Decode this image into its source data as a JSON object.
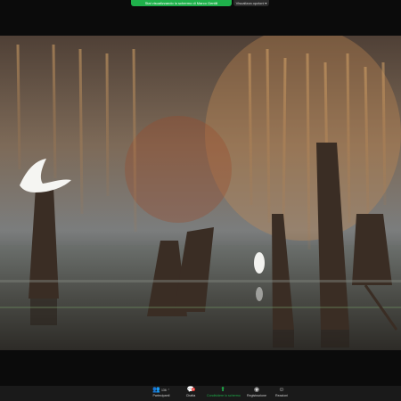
{
  "share_banner": {
    "label": "Stai visualizzando lo schermo di Marco Gentili"
  },
  "view_options": {
    "label": "Visualizza opzioni"
  },
  "toolbar": {
    "participants_label": "Partecipanti",
    "participants_count": "136",
    "chat_label": "Chatta",
    "chat_badge": "8",
    "share_label": "Condividere lo schermo",
    "record_label": "Registrazione",
    "reactions_label": "Reazioni"
  },
  "colors": {
    "share_green": "#1fb14b",
    "toolbar_bg": "#1a1a1a",
    "page_bg": "#0b0b0b"
  },
  "icons": [
    "participants-icon",
    "chat-icon",
    "share-screen-icon",
    "record-icon",
    "reactions-icon",
    "chevron-down-icon"
  ]
}
